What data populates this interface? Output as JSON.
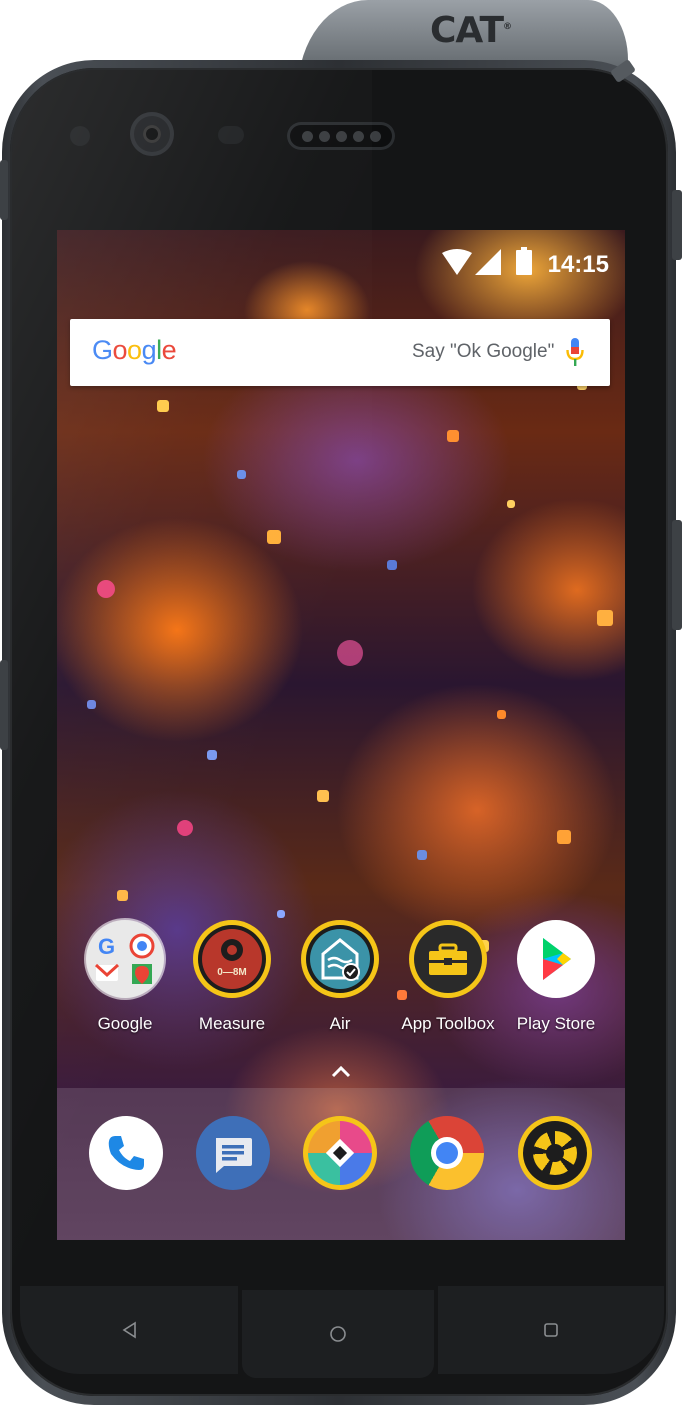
{
  "device": {
    "brand_logo": "CAT",
    "trademark": "®"
  },
  "status_bar": {
    "time": "14:15",
    "icons": [
      "wifi-icon",
      "signal-icon",
      "battery-icon"
    ]
  },
  "search_bar": {
    "logo_text": "Google",
    "logo_colors": [
      "#4285F4",
      "#EA4335",
      "#FBBC05",
      "#4285F4",
      "#34A853",
      "#EA4335"
    ],
    "hint": "Say \"Ok Google\"",
    "mic_icon": "mic-icon"
  },
  "home_apps": [
    {
      "label": "Google",
      "icon": "google-folder-icon"
    },
    {
      "label": "Measure",
      "icon": "measure-icon"
    },
    {
      "label": "Air",
      "icon": "air-icon"
    },
    {
      "label": "App Toolbox",
      "icon": "toolbox-icon"
    },
    {
      "label": "Play Store",
      "icon": "play-store-icon"
    }
  ],
  "measure_icon_text": "0—8M",
  "dock_apps": [
    {
      "name": "Phone",
      "icon": "phone-icon"
    },
    {
      "name": "Messages",
      "icon": "messages-icon"
    },
    {
      "name": "Launcher",
      "icon": "launcher-icon"
    },
    {
      "name": "Chrome",
      "icon": "chrome-icon"
    },
    {
      "name": "Camera",
      "icon": "camera-icon"
    }
  ],
  "nav_buttons": [
    "back-icon",
    "home-icon",
    "recents-icon"
  ],
  "colors": {
    "cat_yellow": "#f5c518",
    "measure_red": "#b8372b",
    "air_teal": "#3b93a8",
    "phone_blue": "#1e88e5",
    "messages_blue": "#3e6fb8"
  }
}
